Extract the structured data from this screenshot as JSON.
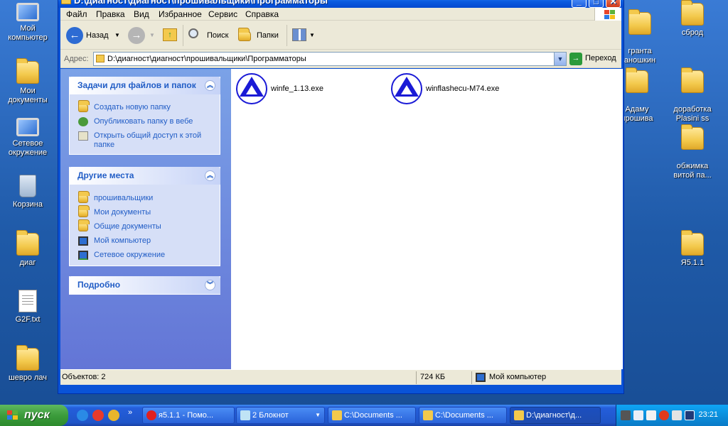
{
  "desktop": {
    "icons_left": [
      {
        "label": "Мой компьютер",
        "icon": "monitor-icon"
      },
      {
        "label": "Мои документы",
        "icon": "documents-folder-icon"
      },
      {
        "label": "Сетевое окружение",
        "icon": "network-icon"
      },
      {
        "label": "Корзина",
        "icon": "recycle-bin-icon"
      },
      {
        "label": "диаг",
        "icon": "folder-icon"
      },
      {
        "label": "G2F.txt",
        "icon": "text-file-icon"
      },
      {
        "label": "шевро лач",
        "icon": "folder-icon"
      }
    ],
    "icons_right": [
      {
        "label": "гранта\nаношкин",
        "icon": "folder-icon"
      },
      {
        "label": "сброд",
        "icon": "folder-icon"
      },
      {
        "label": "Адаму\nпрошива",
        "icon": "folder-icon"
      },
      {
        "label": "доработка\nPlasini ss",
        "icon": "folder-icon"
      },
      {
        "label": "обжимка\nвитой па...",
        "icon": "folder-icon"
      },
      {
        "label": "Я5.1.1",
        "icon": "folder-icon"
      }
    ]
  },
  "window": {
    "title": "D:\\диагност\\диагност\\прошивальщики\\Программаторы",
    "menu": [
      "Файл",
      "Правка",
      "Вид",
      "Избранное",
      "Сервис",
      "Справка"
    ],
    "toolbar": {
      "back": "Назад",
      "search": "Поиск",
      "folders": "Папки"
    },
    "address": {
      "label": "Адрес:",
      "value": "D:\\диагност\\диагност\\прошивальщики\\Программаторы",
      "go": "Переход"
    },
    "tasks_panel": {
      "title": "Задачи для файлов и папок",
      "items": [
        "Создать новую папку",
        "Опубликовать папку в вебе",
        "Открыть общий доступ к этой папке"
      ]
    },
    "places_panel": {
      "title": "Другие места",
      "items": [
        "прошивальщики",
        "Мои документы",
        "Общие документы",
        "Мой компьютер",
        "Сетевое окружение"
      ]
    },
    "details_panel": {
      "title": "Подробно"
    },
    "files": [
      {
        "name": "winfe_1.13.exe",
        "icon": "program-icon"
      },
      {
        "name": "winflashecu-M74.exe",
        "icon": "program-icon"
      }
    ],
    "status": {
      "objects": "Объектов: 2",
      "size": "724 КБ",
      "location": "Мой компьютер"
    }
  },
  "taskbar": {
    "start": "пуск",
    "tasks": [
      {
        "label": "я5.1.1 - Помо...",
        "active": false
      },
      {
        "label": "2 Блокнот",
        "active": false
      },
      {
        "label": "C:\\Documents ...",
        "active": false
      },
      {
        "label": "C:\\Documents ...",
        "active": false
      },
      {
        "label": "D:\\диагност\\д...",
        "active": true
      }
    ],
    "clock": "23:21"
  },
  "colors": {
    "xp_blue": "#0a53d7",
    "link_blue": "#215dc6",
    "start_green": "#3c9c3c"
  }
}
